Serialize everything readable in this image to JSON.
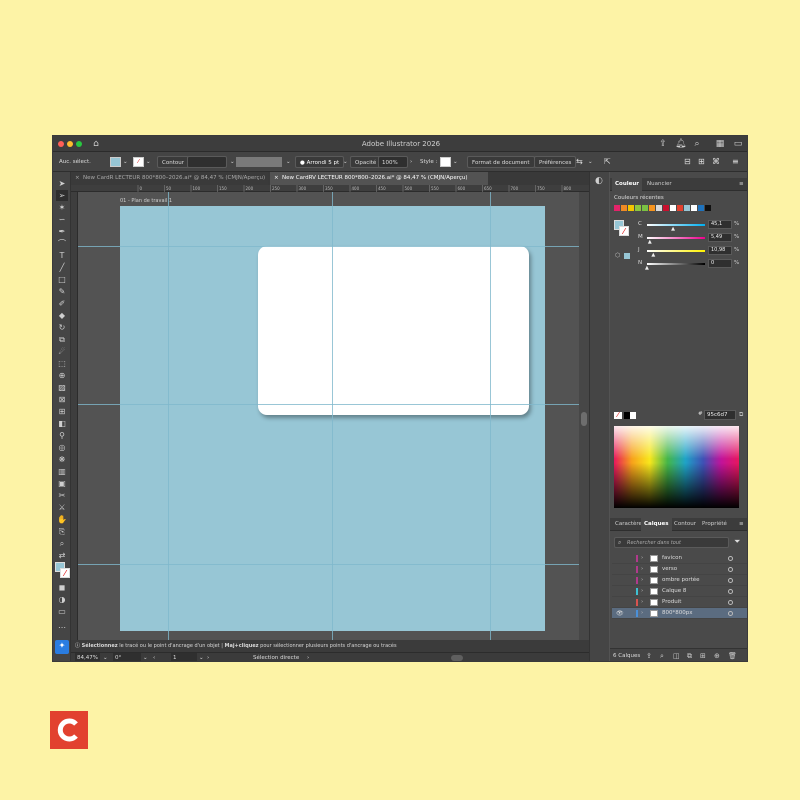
{
  "app": {
    "title": "Adobe Illustrator 2026"
  },
  "control_bar": {
    "selection_label": "Auc. sélect.",
    "stroke_label": "Contour",
    "corner_label": "Arrondi 5 pt",
    "opacity_label": "Opacité",
    "opacity_value": "100%",
    "style_label": "Style :",
    "doc_format_button": "Format de document",
    "preferences_button": "Préférences"
  },
  "tabs": [
    {
      "label": "New CardR LECTEUR 800*800–2026.ai* @ 84,47 % (CMJN/Aperçu)",
      "active": false
    },
    {
      "label": "New CardRV LECTEUR 800*800–2026.ai* @ 84,47 % (CMJN/Aperçu)",
      "active": true
    }
  ],
  "ruler_ticks": [
    "0",
    "50",
    "100",
    "150",
    "200",
    "250",
    "300",
    "350",
    "400",
    "450",
    "500",
    "550",
    "600",
    "650",
    "700",
    "750",
    "800"
  ],
  "canvas": {
    "artboard_label": "01 - Plan de travail 1",
    "artboard_color": "#97c6d5",
    "card_color": "#ffffff"
  },
  "hint_bar": {
    "text_bold_1": "Sélectionnez",
    "text_1": " le tracé ou le point d'ancrage d'un objet  |  ",
    "text_bold_2": "Maj+cliquez",
    "text_2": " pour sélectionner plusieurs points d'ancrage ou tracés"
  },
  "status_bar": {
    "zoom": "84,47%",
    "rotation": "0°",
    "artboard_number": "1",
    "tool_name": "Sélection directe"
  },
  "color_panel": {
    "tabs": [
      "Couleur",
      "Nuancier"
    ],
    "recent_label": "Couleurs récentes",
    "recent_swatches": [
      "#e3236a",
      "#f08a24",
      "#f3c500",
      "#8cc63f",
      "#7ac143",
      "#f7941d",
      "#d9d9d9",
      "#c8102e",
      "#ffffff",
      "#e2412f",
      "#97c6d5",
      "#ffffff",
      "#1e73be",
      "#111111"
    ],
    "channels": [
      {
        "label": "C",
        "value": "45,1",
        "pos": 0.45,
        "track": "linear-gradient(to right,#fff,#00aeef)"
      },
      {
        "label": "M",
        "value": "5,49",
        "pos": 0.05,
        "track": "linear-gradient(to right,#fff,#ec008c)"
      },
      {
        "label": "J",
        "value": "10,98",
        "pos": 0.11,
        "track": "linear-gradient(to right,#fff,#fff200)"
      },
      {
        "label": "N",
        "value": "0",
        "pos": 0.0,
        "track": "linear-gradient(to right,#fff,#000)"
      }
    ],
    "percent_sign": "%",
    "hex_prefix": "#",
    "hex_value": "95c6d7",
    "fill_color": "#97c6d5"
  },
  "layers_panel": {
    "tabs": [
      "Caractère",
      "Calques",
      "Contour",
      "Propriété"
    ],
    "search_placeholder": "Rechercher dans tout",
    "layers": [
      {
        "name": "favicon",
        "color": "#b03a8c",
        "visible": false,
        "selected": false
      },
      {
        "name": "verso",
        "color": "#b03a8c",
        "visible": false,
        "selected": false
      },
      {
        "name": "ombre portée",
        "color": "#b03a8c",
        "visible": false,
        "selected": false
      },
      {
        "name": "Calque 8",
        "color": "#3ec1d3",
        "visible": false,
        "selected": false
      },
      {
        "name": "Produit",
        "color": "#d9534f",
        "visible": false,
        "selected": false
      },
      {
        "name": "800*800px",
        "color": "#4a90d9",
        "visible": true,
        "selected": true
      }
    ],
    "count_label": "6 Calques"
  },
  "logo": {
    "letter": "C",
    "color": "#e2412f"
  }
}
